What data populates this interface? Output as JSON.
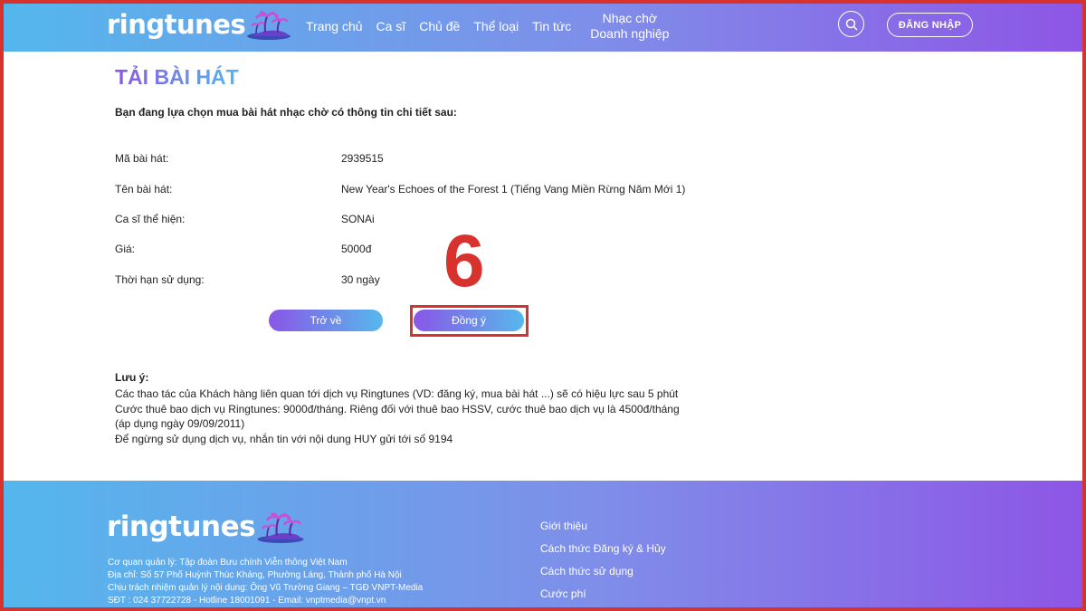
{
  "header": {
    "logo_text": "ringtunes",
    "nav": [
      "Trang chủ",
      "Ca sĩ",
      "Chủ đề",
      "Thể loại",
      "Tin tức"
    ],
    "nav_two_line": [
      "Nhạc chờ",
      "Doanh nghiệp"
    ],
    "login_label": "ĐĂNG NHẬP",
    "search_icon": "search-icon"
  },
  "main": {
    "title": "TẢI BÀI HÁT",
    "intro": "Bạn đang lựa chọn mua bài hát nhạc chờ có thông tin chi tiết sau:",
    "rows": [
      {
        "label": "Mã bài hát:",
        "value": "2939515"
      },
      {
        "label": "Tên bài hát:",
        "value": "New Year's Echoes of the Forest 1 (Tiếng Vang Miền Rừng Năm Mới 1)"
      },
      {
        "label": "Ca sĩ thể hiện:",
        "value": "SONAi"
      },
      {
        "label": "Giá:",
        "value": "5000đ"
      },
      {
        "label": "Thời hạn sử dụng:",
        "value": "30 ngày"
      }
    ],
    "back_label": "Trở về",
    "agree_label": "Đồng ý",
    "step_number": "6",
    "note_title": "Lưu ý:",
    "notes": [
      "Các thao tác của Khách hàng liên quan tới dịch vụ Ringtunes (VD: đăng ký, mua bài hát ...) sẽ có hiệu lực sau 5 phút",
      "Cước thuê bao dịch vụ Ringtunes: 9000đ/tháng. Riêng đối với thuê bao HSSV, cước thuê bao dịch vụ là 4500đ/tháng",
      "(áp dụng ngày 09/09/2011)",
      "Để ngừng sử dụng dịch vụ, nhắn tin với nội dung HUY gửi tới số 9194"
    ]
  },
  "footer": {
    "logo_text": "ringtunes",
    "info": [
      "Cơ quan quản lý: Tập đoàn Bưu chính Viễn thông Việt Nam",
      "Địa chỉ: Số 57 Phố Huỳnh Thúc Kháng, Phường Láng, Thành phố Hà Nội",
      "Chịu trách nhiệm quản lý nội dung: Ông Vũ Trường Giang – TGĐ VNPT-Media",
      "SĐT : 024 37722728 - Hotline 18001091 - Email: vnptmedia@vnpt.vn"
    ],
    "links": [
      "Giới thiệu",
      "Cách thức Đăng ký & Hủy",
      "Cách thức sử dụng",
      "Cước phí"
    ]
  },
  "colors": {
    "accent_red": "#d8322f",
    "gradient_start": "#54b7ec",
    "gradient_end": "#8e55e6"
  }
}
